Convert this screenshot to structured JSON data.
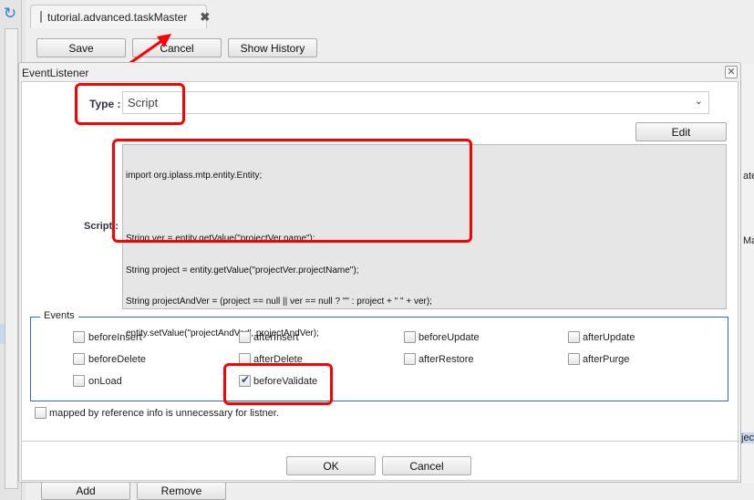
{
  "app": {
    "tab": {
      "label": "tutorial.advanced.taskMaster",
      "icon": "database-icon"
    },
    "toolbar": {
      "save": "Save",
      "cancel": "Cancel",
      "show_history": "Show History"
    },
    "bottom": {
      "add": "Add",
      "remove": "Remove"
    },
    "right_fragments": [
      "ate",
      "Ma",
      "jec"
    ]
  },
  "dialog": {
    "title": "EventListener",
    "type_label": "Type :",
    "type_value": "Script",
    "edit_button": "Edit",
    "script_label": "Script :",
    "script_lines": [
      "import org.iplass.mtp.entity.Entity;",
      "",
      "String ver = entity.getValue(\"projectVer.name\");",
      "String project = entity.getValue(\"projectVer.projectName\");",
      "String projectAndVer = (project == null || ver == null ? \"\" : project + \" \" + ver);",
      "entity.setValue(\"projectAndVer\", projectAndVer);"
    ],
    "events_legend": "Events",
    "events": [
      {
        "label": "beforeInsert",
        "checked": false
      },
      {
        "label": "afterInsert",
        "checked": false
      },
      {
        "label": "beforeUpdate",
        "checked": false
      },
      {
        "label": "afterUpdate",
        "checked": false
      },
      {
        "label": "beforeDelete",
        "checked": false
      },
      {
        "label": "afterDelete",
        "checked": false
      },
      {
        "label": "afterRestore",
        "checked": false
      },
      {
        "label": "afterPurge",
        "checked": false
      },
      {
        "label": "onLoad",
        "checked": false
      },
      {
        "label": "beforeValidate",
        "checked": true
      }
    ],
    "mapped_label": "mapped by reference info is unnecessary for listner.",
    "mapped_checked": false,
    "ok": "OK",
    "cancel": "Cancel"
  },
  "annotation_color": "#ff0000"
}
